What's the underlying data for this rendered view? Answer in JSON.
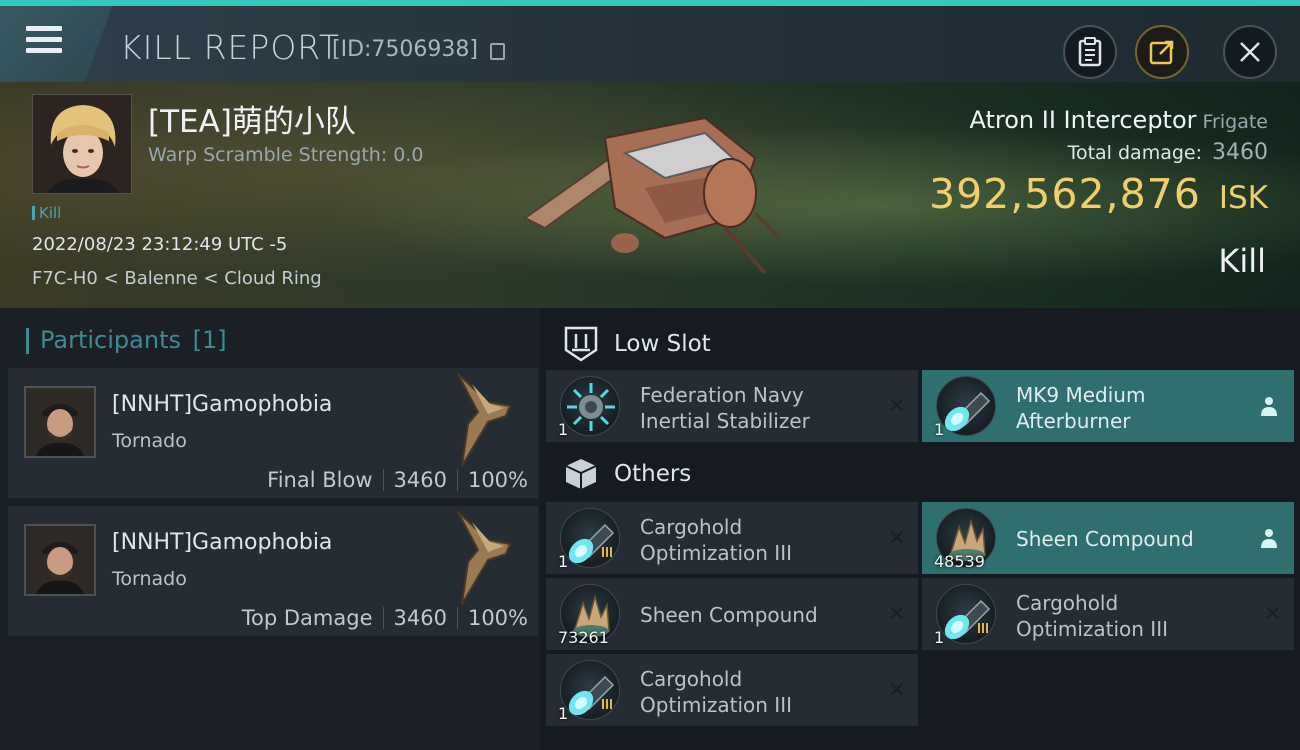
{
  "header": {
    "title": "KILL REPORT",
    "report_id": "[ID:7506938]"
  },
  "victim": {
    "name": "[TEA]萌的小队",
    "warp_scramble": "Warp Scramble Strength: 0.0",
    "kill_tag": "Kill",
    "datetime": "2022/08/23 23:12:49 UTC -5",
    "location": "F7C-H0 < Balenne < Cloud Ring",
    "ship_name": "Atron II Interceptor",
    "ship_class": "Frigate",
    "total_damage_label": "Total damage:",
    "total_damage": "3460",
    "isk_value": "392,562,876",
    "isk_unit": "ISK",
    "result": "Kill"
  },
  "participants": {
    "label": "Participants",
    "count": "[1]",
    "list": [
      {
        "name": "[NNHT]Gamophobia",
        "ship": "Tornado",
        "role": "Final Blow",
        "damage": "3460",
        "percent": "100%"
      },
      {
        "name": "[NNHT]Gamophobia",
        "ship": "Tornado",
        "role": "Top Damage",
        "damage": "3460",
        "percent": "100%"
      }
    ]
  },
  "sections": {
    "low_slot": "Low Slot",
    "others": "Others"
  },
  "low_slot_items": [
    {
      "name": "Federation Navy Inertial Stabilizer",
      "qty": "1",
      "status": "destroyed"
    },
    {
      "name": "MK9 Medium Afterburner",
      "qty": "1",
      "status": "dropped"
    }
  ],
  "other_items": [
    {
      "name": "Cargohold Optimization III",
      "qty": "1",
      "status": "destroyed"
    },
    {
      "name": "Sheen Compound",
      "qty": "48539",
      "status": "dropped"
    },
    {
      "name": "Sheen Compound",
      "qty": "73261",
      "status": "destroyed"
    },
    {
      "name": "Cargohold Optimization III",
      "qty": "1",
      "status": "destroyed"
    },
    {
      "name": "Cargohold Optimization III",
      "qty": "1",
      "status": "destroyed"
    }
  ],
  "colors": {
    "accent": "#35c8bd",
    "isk": "#f0cf6b",
    "dropped_highlight": "#2f6f70"
  }
}
